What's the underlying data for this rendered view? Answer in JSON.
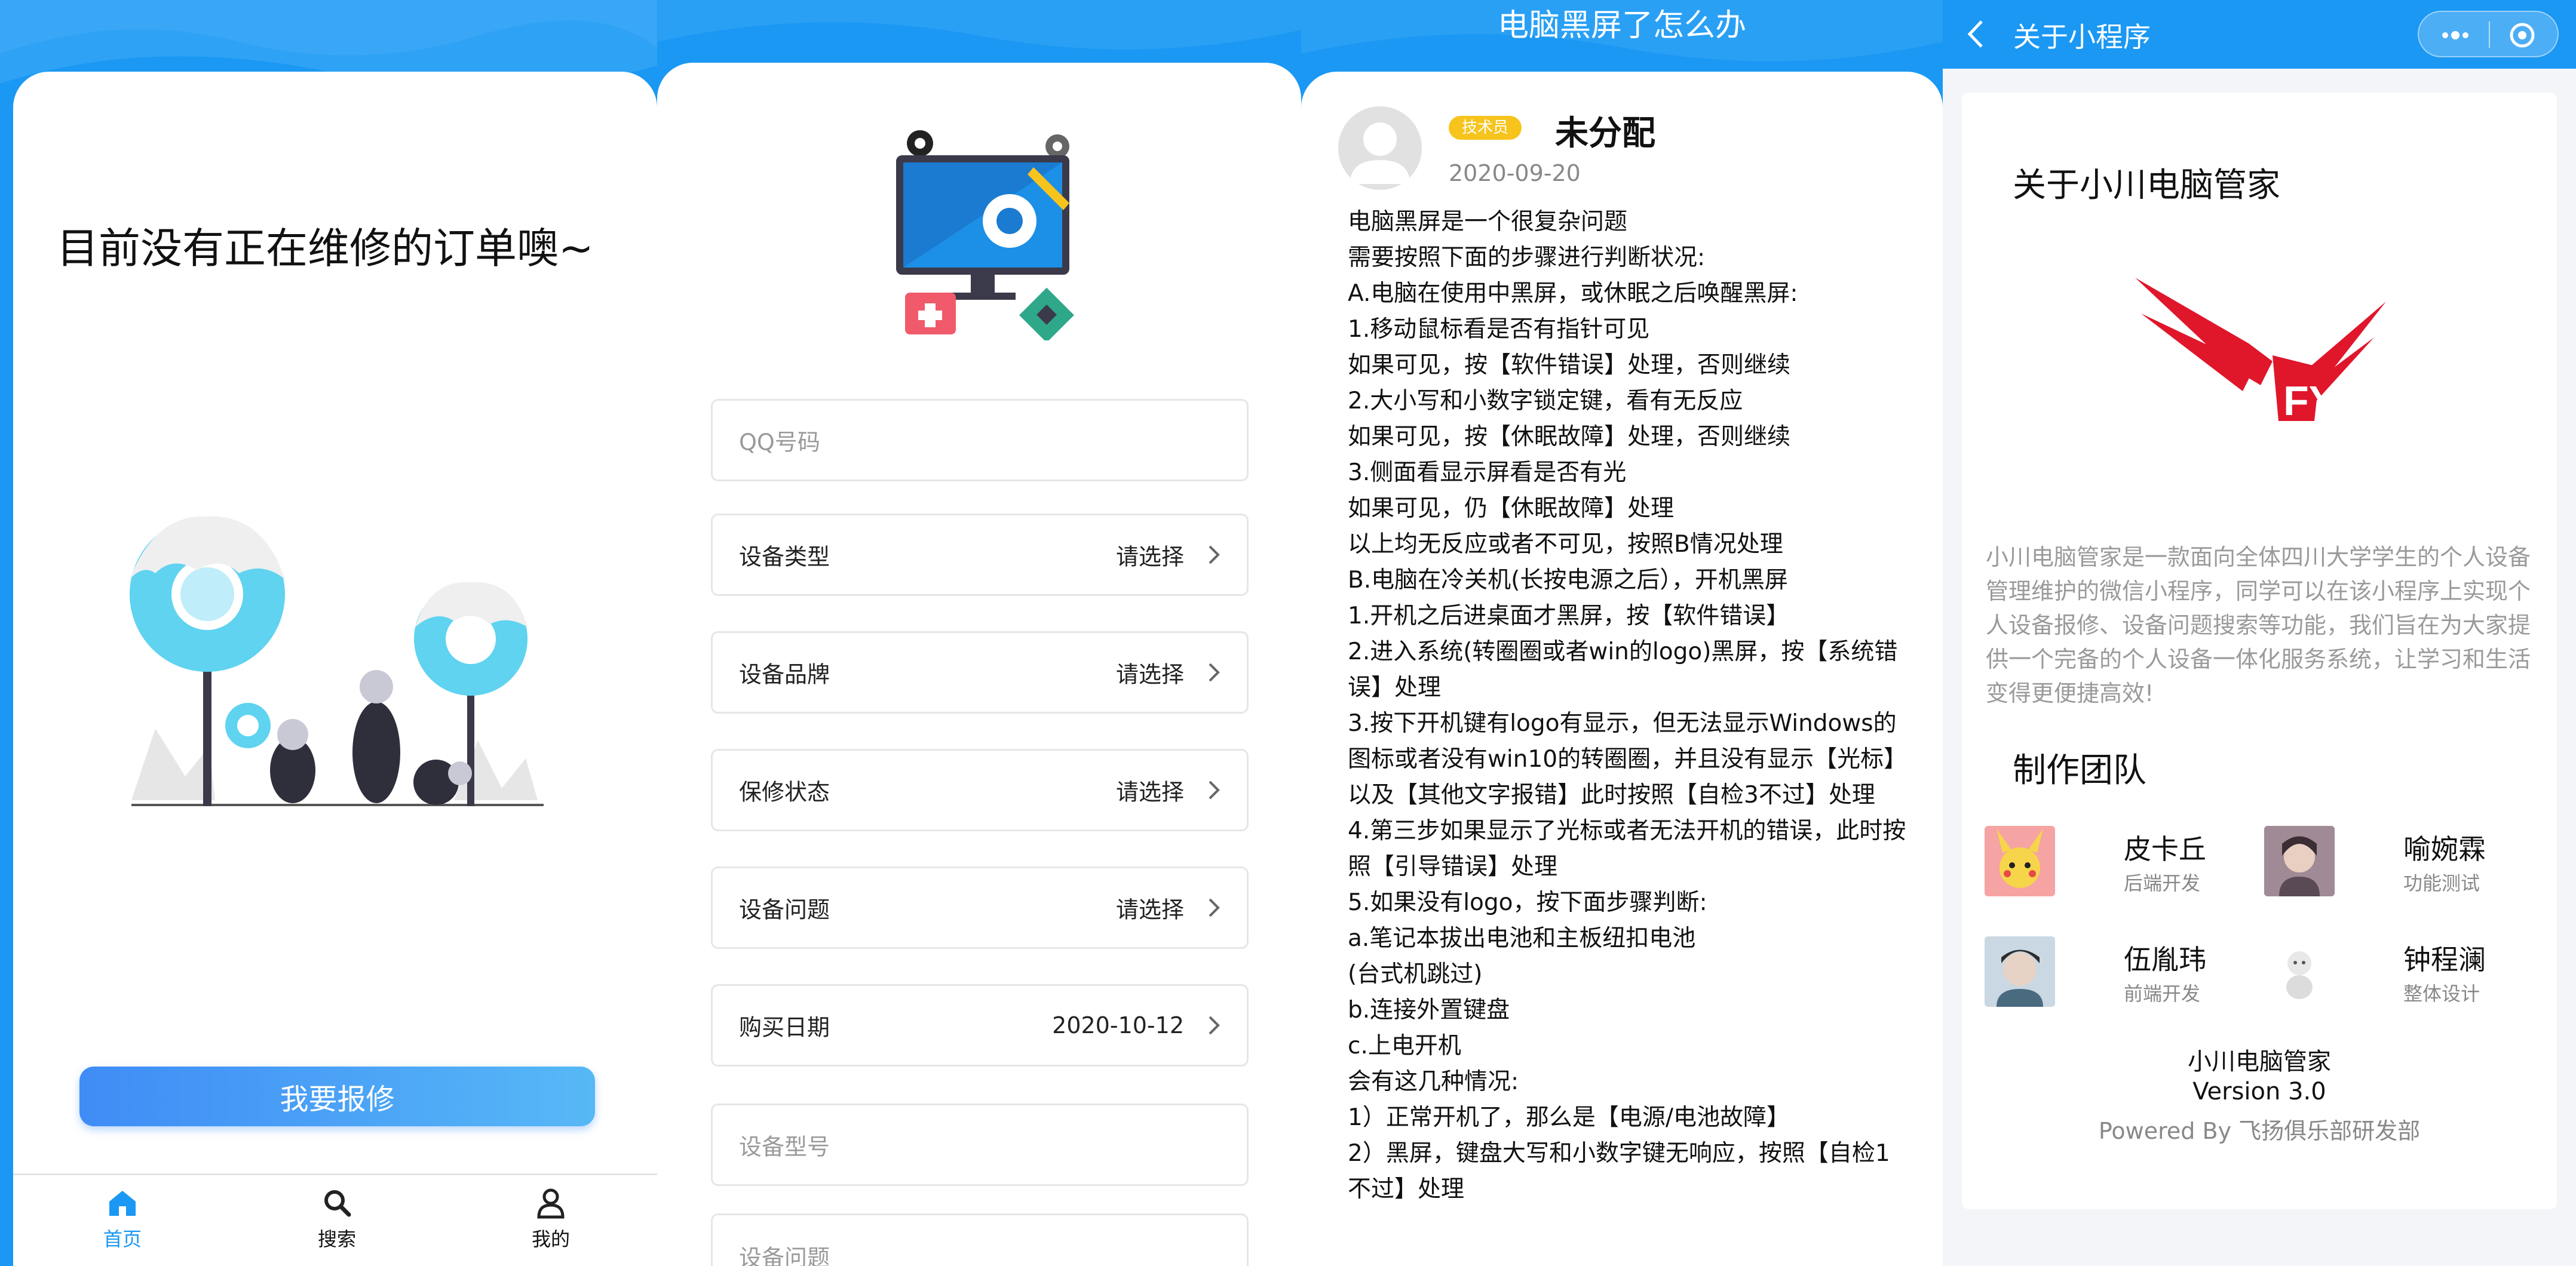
{
  "panel1": {
    "title": "目前没有正在维修的订单噢~",
    "repair_button": "我要报修",
    "tabs": [
      {
        "label": "首页",
        "icon": "home-icon"
      },
      {
        "label": "搜索",
        "icon": "search-icon"
      },
      {
        "label": "我的",
        "icon": "user-icon"
      }
    ]
  },
  "panel2": {
    "qq_placeholder": "QQ号码",
    "fields": [
      {
        "label": "设备类型",
        "value": "请选择"
      },
      {
        "label": "设备品牌",
        "value": "请选择"
      },
      {
        "label": "保修状态",
        "value": "请选择"
      },
      {
        "label": "设备问题",
        "value": "请选择"
      },
      {
        "label": "购买日期",
        "value": "2020-10-12"
      }
    ],
    "model_placeholder": "设备型号",
    "problem_placeholder": "设备问题"
  },
  "panel3": {
    "title": "电脑黑屏了怎么办",
    "badge": "技术员",
    "author": "未分配",
    "date": "2020-09-20",
    "lines": [
      "电脑黑屏是一个很复杂问题",
      "需要按照下面的步骤进行判断状况:",
      "A.电脑在使用中黑屏，或休眠之后唤醒黑屏:",
      "1.移动鼠标看是否有指针可见",
      "如果可见，按【软件错误】处理，否则继续",
      "2.大小写和小数字锁定键，看有无反应",
      "如果可见，按【休眠故障】处理，否则继续",
      "3.侧面看显示屏看是否有光",
      "如果可见，仍【休眠故障】处理",
      "以上均无反应或者不可见，按照B情况处理",
      "B.电脑在冷关机(长按电源之后），开机黑屏",
      "1.开机之后进桌面才黑屏，按【软件错误】",
      "2.进入系统(转圈圈或者win的logo)黑屏，按【系统错误】处理",
      "3.按下开机键有logo有显示，但无法显示Windows的图标或者没有win10的转圈圈，并且没有显示【光标】以及【其他文字报错】此时按照【自检3不过】处理",
      "4.第三步如果显示了光标或者无法开机的错误，此时按照【引导错误】处理",
      "5.如果没有logo，按下面步骤判断:",
      "a.笔记本拔出电池和主板纽扣电池",
      "(台式机跳过)",
      "b.连接外置键盘",
      "c.上电开机",
      "会有这几种情况:",
      "1）正常开机了，那么是【电源/电池故障】",
      "2）黑屏，键盘大写和小数字键无响应，按照【自检1不过】处理"
    ]
  },
  "panel4": {
    "nav_title": "关于小程序",
    "about_title": "关于小川电脑管家",
    "description": "小川电脑管家是一款面向全体四川大学学生的个人设备管理维护的微信小程序，同学可以在该小程序上实现个人设备报修、设备问题搜索等功能，我们旨在为大家提供一个完备的个人设备一体化服务系统，让学习和生活变得更便捷高效!",
    "team_title": "制作团队",
    "members": [
      {
        "name": "皮卡丘",
        "role": "后端开发"
      },
      {
        "name": "喻婉霖",
        "role": "功能测试"
      },
      {
        "name": "伍胤玮",
        "role": "前端开发"
      },
      {
        "name": "钟程澜",
        "role": "整体设计"
      }
    ],
    "app_name": "小川电脑管家",
    "version": "Version 3.0",
    "powered": "Powered By 飞扬俱乐部研发部"
  },
  "colors": {
    "primary": "#1a98f3",
    "badge": "#f7c41d",
    "logo_red": "#e0162b"
  }
}
